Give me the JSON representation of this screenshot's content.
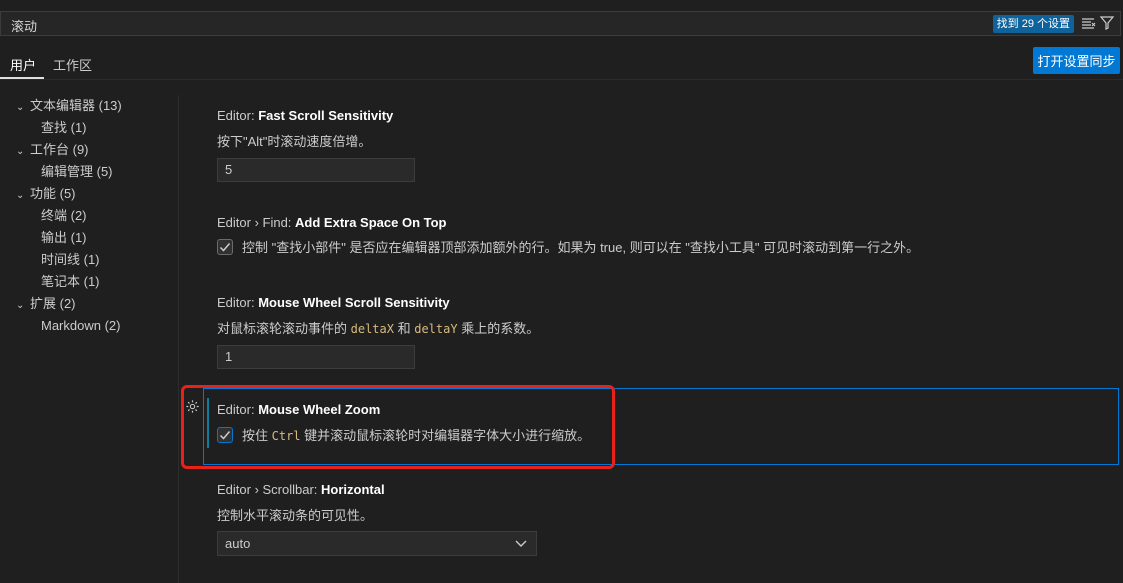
{
  "search": {
    "query": "滚动",
    "result_count": "找到 29 个设置"
  },
  "tabs": [
    {
      "label": "用户"
    },
    {
      "label": "工作区"
    }
  ],
  "sync_button": "打开设置同步",
  "tree": [
    {
      "label": "文本编辑器 (13)",
      "level": 0
    },
    {
      "label": "查找 (1)",
      "level": 1
    },
    {
      "label": "工作台 (9)",
      "level": 0
    },
    {
      "label": "编辑管理 (5)",
      "level": 1
    },
    {
      "label": "功能 (5)",
      "level": 0
    },
    {
      "label": "终端 (2)",
      "level": 1
    },
    {
      "label": "输出 (1)",
      "level": 1
    },
    {
      "label": "时间线 (1)",
      "level": 1
    },
    {
      "label": "笔记本 (1)",
      "level": 1
    },
    {
      "label": "扩展 (2)",
      "level": 0
    },
    {
      "label": "Markdown (2)",
      "level": 1
    }
  ],
  "settings": {
    "fast_scroll": {
      "prefix": "Editor: ",
      "name": "Fast Scroll Sensitivity",
      "desc": "按下\"Alt\"时滚动速度倍增。",
      "value": "5"
    },
    "find_space": {
      "prefix": "Editor › Find: ",
      "name": "Add Extra Space On Top",
      "desc": "控制 \"查找小部件\" 是否应在编辑器顶部添加额外的行。如果为 true, 则可以在 \"查找小工具\" 可见时滚动到第一行之外。",
      "checked": true
    },
    "wheel_sens": {
      "prefix": "Editor: ",
      "name": "Mouse Wheel Scroll Sensitivity",
      "desc_a": "对鼠标滚轮滚动事件的 ",
      "code_a": "deltaX",
      "desc_b": " 和 ",
      "code_b": "deltaY",
      "desc_c": " 乘上的系数。",
      "value": "1"
    },
    "wheel_zoom": {
      "prefix": "Editor: ",
      "name": "Mouse Wheel Zoom",
      "desc_a": "按住 ",
      "code": "Ctrl",
      "desc_b": " 键并滚动鼠标滚轮时对编辑器字体大小进行缩放。",
      "checked": true
    },
    "scrollbar_h": {
      "prefix": "Editor › Scrollbar: ",
      "name": "Horizontal",
      "desc": "控制水平滚动条的可见性。",
      "value": "auto"
    }
  },
  "colors": {
    "accent": "#0078d4",
    "highlight": "#e8221b",
    "background": "#1f1f1f"
  }
}
